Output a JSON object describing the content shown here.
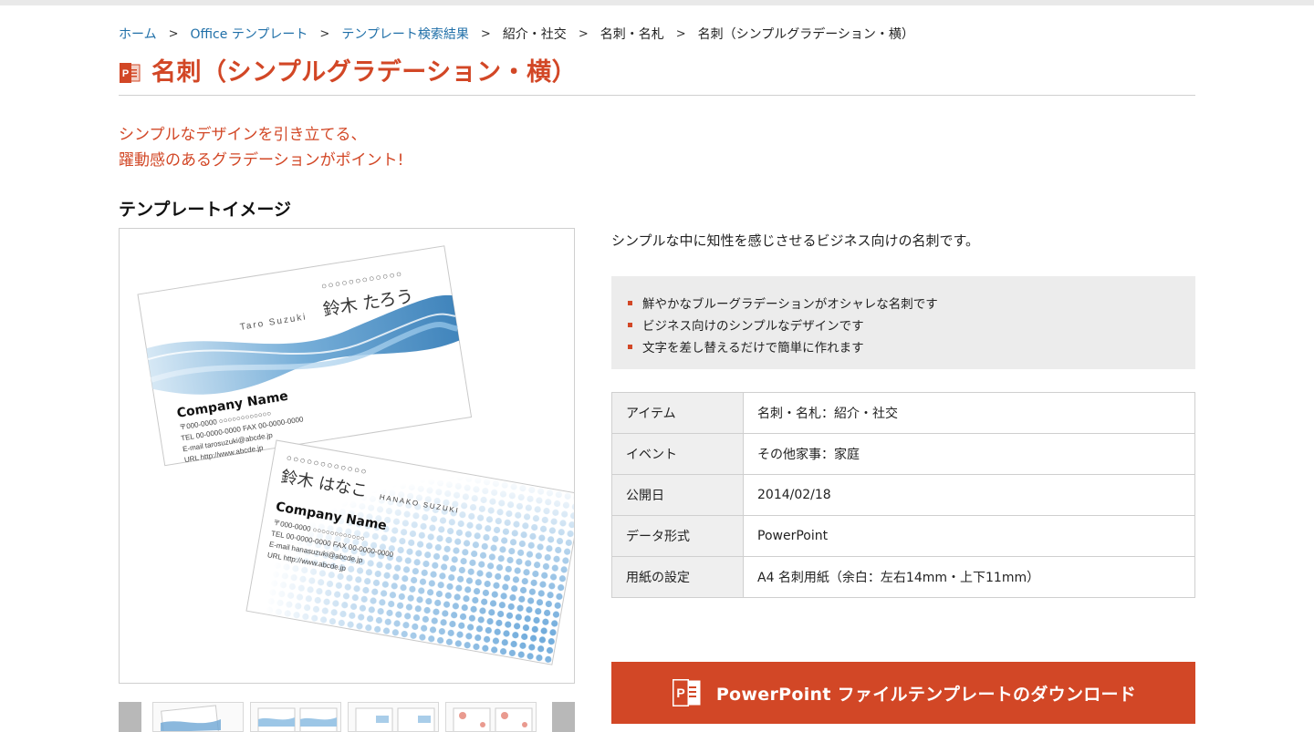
{
  "breadcrumb": {
    "items": [
      {
        "label": "ホーム",
        "link": true
      },
      {
        "label": "Office テンプレート",
        "link": true
      },
      {
        "label": "テンプレート検索結果",
        "link": true
      },
      {
        "label": "紹介・社交",
        "link": false
      },
      {
        "label": "名刺・名札",
        "link": false
      },
      {
        "label": "名刺（シンプルグラデーション・横）",
        "link": false
      }
    ],
    "separator": ">"
  },
  "page": {
    "title": "名刺（シンプルグラデーション・横）",
    "title_icon": "powerpoint-icon",
    "catch_line1": "シンプルなデザインを引き立てる、",
    "catch_line2": "躍動感のあるグラデーションがポイント!",
    "accent_color": "#d24726"
  },
  "template_image": {
    "heading": "テンプレートイメージ",
    "card1": {
      "circles": "○○○○○○○○○○○○",
      "name_romaji": "Taro Suzuki",
      "name_jp": "鈴木 たろう",
      "company": "Company Name",
      "lines": [
        "〒000-0000  ○○○○○○○○○○○○",
        "TEL 00-0000-0000  FAX 00-0000-0000",
        "E-mail tarosuzuki@abcde.jp",
        "URL http://www.abcde.jp"
      ]
    },
    "card2": {
      "circles": "○○○○○○○○○○○○",
      "name_jp": "鈴木 はなこ",
      "name_romaji": "HANAKO SUZUKI",
      "company": "Company Name",
      "lines": [
        "〒000-0000  ○○○○○○○○○○○○",
        "TEL 00-0000-0000  FAX 00-0000-0000",
        "E-mail hanasuzuki@abcde.jp",
        "URL http://www.abcde.jp"
      ]
    }
  },
  "description": "シンプルな中に知性を感じさせるビジネス向けの名刺です。",
  "features": [
    "鮮やかなブルーグラデーションがオシャレな名刺です",
    "ビジネス向けのシンプルなデザインです",
    "文字を差し替えるだけで簡単に作れます"
  ],
  "info": [
    {
      "key": "アイテム",
      "value": "名刺・名札：紹介・社交"
    },
    {
      "key": "イベント",
      "value": "その他家事：家庭"
    },
    {
      "key": "公開日",
      "value": "2014/02/18"
    },
    {
      "key": "データ形式",
      "value": "PowerPoint"
    },
    {
      "key": "用紙の設定",
      "value": "A4 名刺用紙（余白：左右14mm・上下11mm）"
    }
  ],
  "download": {
    "label": "PowerPoint ファイルテンプレートのダウンロード",
    "icon": "powerpoint-icon"
  }
}
